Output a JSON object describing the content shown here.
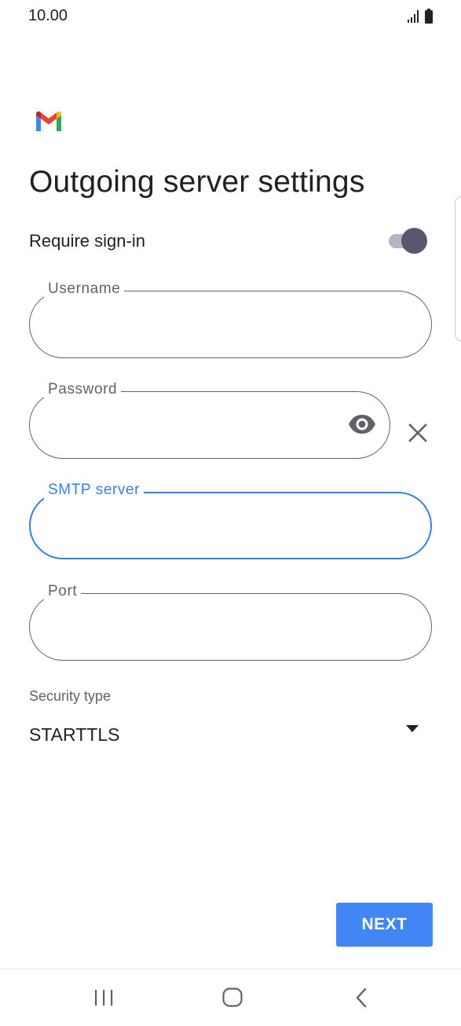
{
  "status_bar": {
    "time": "10.00",
    "icons": [
      "signal-icon",
      "battery-icon"
    ]
  },
  "app": {
    "logo": "gmail-logo",
    "title": "Outgoing server settings"
  },
  "require_signin": {
    "label": "Require sign-in",
    "enabled": true
  },
  "fields": {
    "username": {
      "label": "Username",
      "value": ""
    },
    "password": {
      "label": "Password",
      "value": "",
      "icons": [
        "eye-icon",
        "close-icon"
      ]
    },
    "smtp_server": {
      "label": "SMTP server",
      "value": "",
      "focused": true
    },
    "port": {
      "label": "Port",
      "value": ""
    }
  },
  "security": {
    "label": "Security type",
    "value": "STARTTLS"
  },
  "actions": {
    "next_label": "NEXT"
  },
  "nav_bar": {
    "icons": [
      "recents-icon",
      "home-icon",
      "back-icon"
    ]
  },
  "colors": {
    "accent": "#4285f4",
    "focus": "#3c7fe0",
    "toggle_thumb": "#5a566d",
    "toggle_track": "#b7b3bf",
    "outline": "#5f6368"
  }
}
